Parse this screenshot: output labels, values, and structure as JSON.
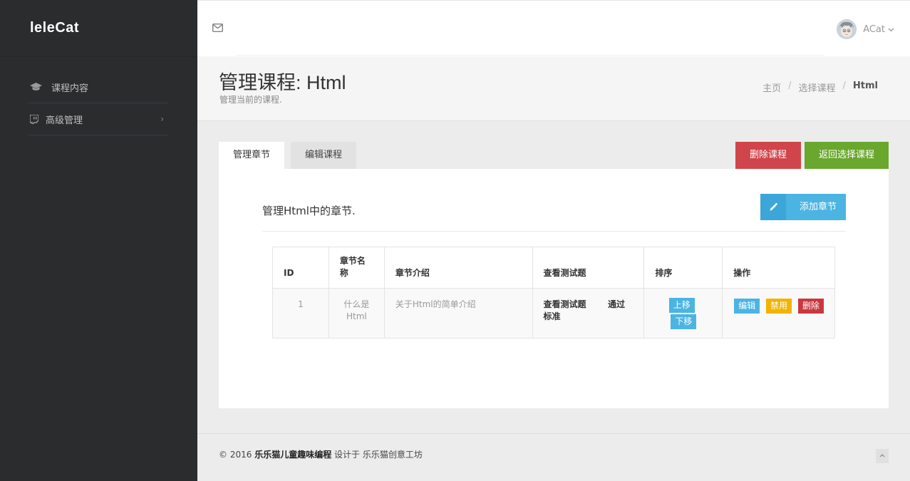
{
  "sidebar": {
    "logo": "leleCat",
    "items": [
      {
        "label": "课程内容",
        "icon": "graduation-cap-icon"
      },
      {
        "label": "高级管理",
        "icon": "twitch-icon"
      }
    ]
  },
  "topbar": {
    "mail_icon": "envelope-icon",
    "user_name": "ACat"
  },
  "header": {
    "title_prefix": "管理课程:",
    "title_course": "Html",
    "subtitle": "管理当前的课程.",
    "breadcrumb": [
      "主页",
      "选择课程",
      "Html"
    ]
  },
  "tabs": [
    "管理章节",
    "编辑课程"
  ],
  "actions": {
    "delete_course": "删除课程",
    "back": "返回选择课程"
  },
  "panel": {
    "title": "管理Html中的章节.",
    "add_button": "添加章节"
  },
  "table": {
    "headers": [
      "ID",
      "章节名称",
      "章节介绍",
      "查看测试题",
      "排序",
      "操作"
    ],
    "rows": [
      {
        "id": "1",
        "name": "什么是Html",
        "intro": "关于Html的简单介绍",
        "view_tests": "查看测试题",
        "pass_standard": "通过标准",
        "move_up": "上移",
        "move_down": "下移",
        "edit": "编辑",
        "disable": "禁用",
        "delete": "删除"
      }
    ]
  },
  "footer": {
    "copyright": "© 2016",
    "brand": "乐乐猫儿童趣味编程",
    "designed_by": "设计于 乐乐猫创意工坊"
  },
  "colors": {
    "sidebar_bg": "#2b2c2e",
    "primary_blue": "#4bb4e2",
    "danger_red": "#d0444b",
    "success_green": "#6aa72e",
    "warning_yellow": "#f2b400"
  }
}
